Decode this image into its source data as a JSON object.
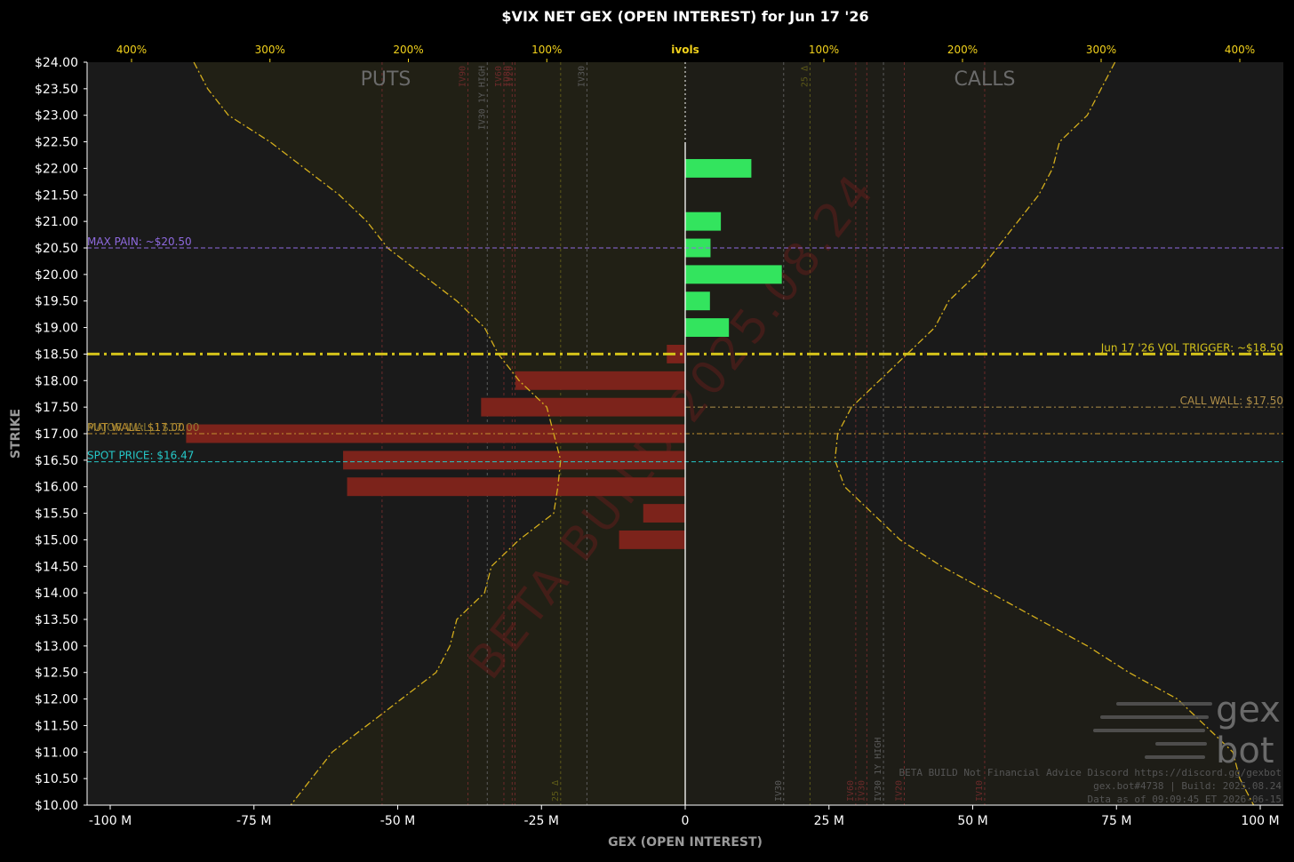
{
  "chart_data": {
    "type": "bar",
    "orientation": "horizontal",
    "title": "$VIX NET GEX (OPEN INTEREST) for Jun 17 '26",
    "xlabel": "GEX (OPEN INTEREST)",
    "ylabel": "STRIKE",
    "top_axis_label": "ivols",
    "xlim": [
      -100000000,
      100000000
    ],
    "ylim": [
      10.0,
      24.0
    ],
    "x_ticks": [
      -100000000,
      -75000000,
      -50000000,
      -25000000,
      0,
      25000000,
      50000000,
      75000000,
      100000000
    ],
    "x_tick_labels": [
      "-100 M",
      "-75 M",
      "-50 M",
      "-25 M",
      "0",
      "25 M",
      "50 M",
      "75 M",
      "100 M"
    ],
    "y_ticks": [
      10.0,
      10.5,
      11.0,
      11.5,
      12.0,
      12.5,
      13.0,
      13.5,
      14.0,
      14.5,
      15.0,
      15.5,
      16.0,
      16.5,
      17.0,
      17.5,
      18.0,
      18.5,
      19.0,
      19.5,
      20.0,
      20.5,
      21.0,
      21.5,
      22.0,
      22.5,
      23.0,
      23.5,
      24.0
    ],
    "y_tick_labels": [
      "$10.00",
      "$10.50",
      "$11.00",
      "$11.50",
      "$12.00",
      "$12.50",
      "$13.00",
      "$13.50",
      "$14.00",
      "$14.50",
      "$15.00",
      "$15.50",
      "$16.00",
      "$16.50",
      "$17.00",
      "$17.50",
      "$18.00",
      "$18.50",
      "$19.00",
      "$19.50",
      "$20.00",
      "$20.50",
      "$21.00",
      "$21.50",
      "$22.00",
      "$22.50",
      "$23.00",
      "$23.50",
      "$24.00"
    ],
    "top_ticks_left": [
      "400%",
      "300%",
      "200%",
      "100%"
    ],
    "top_ticks_right": [
      "100%",
      "200%",
      "300%",
      "400%"
    ],
    "ivol_scale_max": 400,
    "series": [
      {
        "kind": "gex",
        "strikes": [
          22.0,
          21.0,
          20.5,
          20.0,
          19.5,
          19.0,
          18.5,
          18.0,
          17.5,
          17.0,
          16.5,
          16.0,
          15.5,
          15.0
        ],
        "values": [
          11500000,
          6200000,
          4400000,
          16800000,
          4300000,
          7600000,
          -3200000,
          -29500000,
          -35500000,
          -86800000,
          -59500000,
          -58800000,
          -7300000,
          -11500000
        ],
        "pos_color": "#33e45e",
        "neg_color": "#7c231b"
      }
    ],
    "ivol_put_curve": {
      "strikes": [
        24.0,
        23.5,
        23.0,
        22.5,
        22.0,
        21.5,
        21.0,
        20.5,
        20.0,
        19.5,
        19.0,
        18.5,
        18.0,
        17.5,
        17.0,
        16.5,
        16.0,
        15.5,
        15.0,
        14.5,
        14.0,
        13.5,
        13.0,
        12.5,
        12.0,
        11.5,
        11.0,
        10.5,
        10.0
      ],
      "ivol": [
        355,
        345,
        330,
        300,
        275,
        250,
        230,
        215,
        190,
        165,
        145,
        135,
        120,
        100,
        95,
        90,
        92,
        95,
        120,
        140,
        145,
        165,
        170,
        180,
        205,
        230,
        255,
        270,
        285
      ]
    },
    "ivol_call_curve": {
      "strikes": [
        24.0,
        23.5,
        23.0,
        22.5,
        22.0,
        21.5,
        21.0,
        20.5,
        20.0,
        19.5,
        19.0,
        18.5,
        18.0,
        17.5,
        17.0,
        16.5,
        16.0,
        15.5,
        15.0,
        14.5,
        14.0,
        13.5,
        13.0,
        12.5,
        12.0,
        11.5,
        11.0,
        10.5,
        10.0
      ],
      "ivol": [
        310,
        300,
        290,
        270,
        265,
        255,
        240,
        225,
        210,
        190,
        180,
        160,
        140,
        120,
        110,
        108,
        115,
        135,
        155,
        185,
        220,
        255,
        290,
        320,
        355,
        375,
        395,
        400,
        410
      ]
    },
    "levels": [
      {
        "name": "max-pain",
        "label": "MAX PAIN: ~$20.50",
        "strike": 20.5,
        "color": "#8f6ae0",
        "style": "dashed",
        "label_side": "left"
      },
      {
        "name": "vol-trigger",
        "label": "Jun 17 '26 VOL TRIGGER: ~$18.50",
        "strike": 18.5,
        "color": "#d4c21a",
        "style": "dashdot-bold",
        "label_side": "right"
      },
      {
        "name": "call-wall",
        "label": "CALL WALL: $17.50",
        "strike": 17.5,
        "color": "#b08f48",
        "style": "dashdot",
        "label_side": "right",
        "from_zero": true
      },
      {
        "name": "put-wall",
        "label": "PUT WALL: $17.00",
        "strike": 17.0,
        "color": "#c2912f",
        "style": "dashdot",
        "label_side": "left"
      },
      {
        "name": "major-wall",
        "label": "MAJOR WALL: $17.00",
        "strike": 17.0,
        "color": "#9a8535",
        "style": "none",
        "label_side": "left"
      },
      {
        "name": "spot-price",
        "label": "SPOT PRICE: $16.47",
        "strike": 16.47,
        "color": "#25c8c8",
        "style": "dashed",
        "label_side": "left"
      }
    ],
    "vertical_markers": [
      {
        "label": "IV30 1Y HIGH",
        "side": "put",
        "ivol": 143,
        "color": "#5a5a5a",
        "label_pos": "top"
      },
      {
        "label": "IV30",
        "side": "put",
        "ivol": 71,
        "color": "#5a5a5a",
        "label_pos": "top"
      },
      {
        "label": "IV90",
        "side": "put",
        "ivol": 157,
        "color": "#6b2a2a",
        "label_pos": "top"
      },
      {
        "label": "IV60",
        "side": "put",
        "ivol": 131,
        "color": "#6b2a2a",
        "label_pos": "top"
      },
      {
        "label": "IV80",
        "side": "put",
        "ivol": 125,
        "color": "#6b2a2a",
        "label_pos": "top"
      },
      {
        "label": "IV20",
        "side": "put",
        "ivol": 123,
        "color": "#6b2a2a",
        "label_pos": "top"
      },
      {
        "label": "IV10",
        "side": "put",
        "ivol": 219,
        "color": "#6b2a2a",
        "label_pos": "none"
      },
      {
        "label": "25 Δ",
        "side": "put",
        "ivol": 90,
        "color": "#5d5a18",
        "label_pos": "bottom"
      },
      {
        "label": "IV30",
        "side": "call",
        "ivol": 71,
        "color": "#5a5a5a",
        "label_pos": "bottom"
      },
      {
        "label": "25 Δ",
        "side": "call",
        "ivol": 90,
        "color": "#5d5a18",
        "label_pos": "top"
      },
      {
        "label": "IV30 1Y HIGH",
        "side": "call",
        "ivol": 143,
        "color": "#5a5a5a",
        "label_pos": "bottom"
      },
      {
        "label": "IV60",
        "side": "call",
        "ivol": 123,
        "color": "#6b2a2a",
        "label_pos": "bottom"
      },
      {
        "label": "IV30",
        "side": "call",
        "ivol": 131,
        "color": "#6b2a2a",
        "label_pos": "bottom"
      },
      {
        "label": "IV20",
        "side": "call",
        "ivol": 158,
        "color": "#6b2a2a",
        "label_pos": "bottom"
      },
      {
        "label": "IV10",
        "side": "call",
        "ivol": 216,
        "color": "#6b2a2a",
        "label_pos": "bottom"
      }
    ],
    "region_labels": {
      "puts": "PUTS",
      "calls": "CALLS"
    },
    "grid": false,
    "legend": "none"
  },
  "watermark": {
    "text": "BETA BUILD 2025.08.24",
    "color": "#7c1d1d"
  },
  "brand": {
    "line1": "gex",
    "line2": "bot"
  },
  "footer_notes": [
    "BETA BUILD Not Financial Advice Discord https://discord.gg/gexbot",
    "gex.bot#4738 | Build: 2025.08.24",
    "Data as of 09:09:45 ET 2026-06-15"
  ],
  "colors": {
    "background": "#000000",
    "plot_bg": "#1a1a1a",
    "axis_text": "#ffffff",
    "axis_label": "#9a9a9a",
    "ivol_tick": "#f2d21c",
    "ivol_curve": "#d4ae1c",
    "region_label": "#6a6a6a",
    "zero_line": "#ffffff"
  }
}
